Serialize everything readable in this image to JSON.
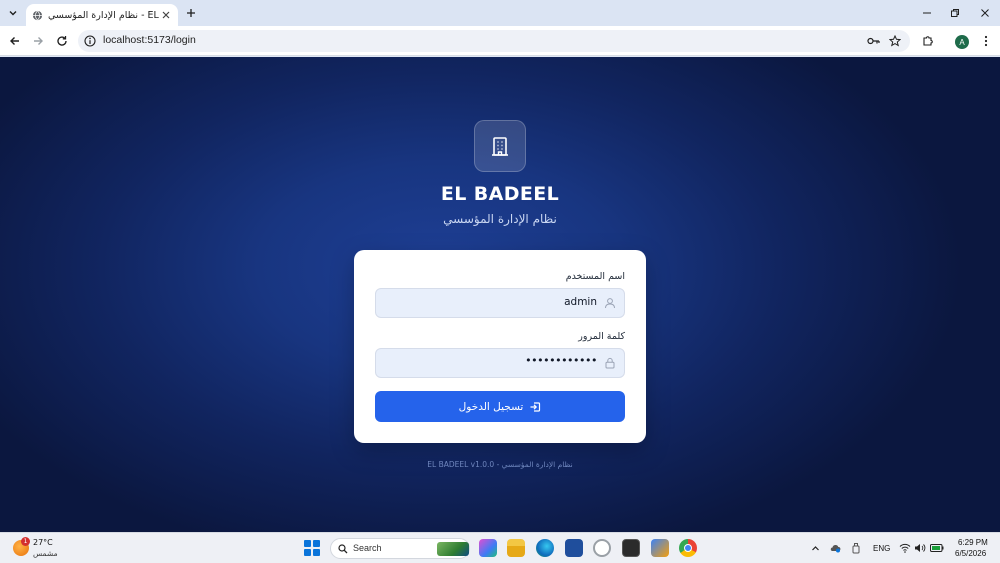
{
  "browser": {
    "tab_title": "نظام الإدارة المؤسسي - EL BADEEL",
    "url": "localhost:5173/login",
    "profile_initial": "A"
  },
  "page": {
    "brand": "EL BADEEL",
    "subtitle": "نظام الإدارة المؤسسي",
    "username_label": "اسم المستخدم",
    "username_value": "admin",
    "password_label": "كلمة المرور",
    "password_value": "••••••••••••",
    "login_button": "تسجيل الدخول",
    "footer": "EL BADEEL v1.0.0 - نظام الإدارة المؤسسي",
    "accent_color": "#2563eb"
  },
  "taskbar": {
    "weather_temp": "27°C",
    "weather_desc": "مشمس",
    "weather_badge": "1",
    "search_label": "Search",
    "language": "ENG",
    "time": "6:29 PM",
    "date": "6/5/2026"
  }
}
